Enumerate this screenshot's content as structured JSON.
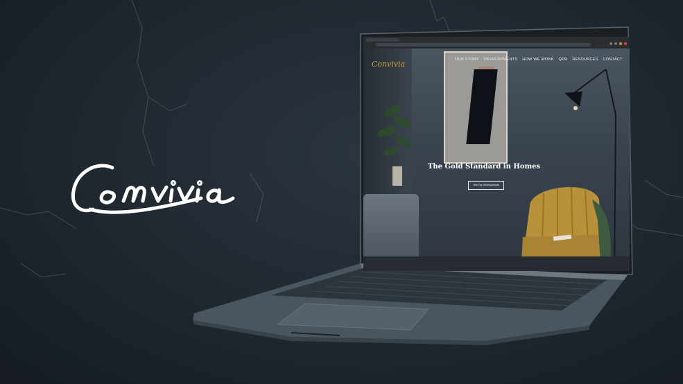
{
  "brand": {
    "name": "Convivia"
  },
  "site": {
    "logo": "Convivia",
    "nav": [
      "OUR STORY",
      "DEVELOPMENTS",
      "HOW WE WORK",
      "QPR",
      "RESOURCES",
      "CONTACT"
    ],
    "hero_title": "The Gold Standard in Homes",
    "cta_label": "See Our Developments"
  },
  "colors": {
    "background": "#1d252d",
    "logo_gold": "#c9a547",
    "text_white": "#ffffff"
  }
}
